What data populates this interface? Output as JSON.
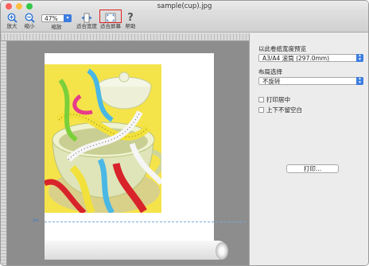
{
  "window": {
    "title": "sample(cup).jpg",
    "traffic_lights": [
      {
        "name": "close",
        "color": "#fc615d"
      },
      {
        "name": "minimize",
        "color": "#fdbc40"
      },
      {
        "name": "zoom",
        "color": "#34c84a"
      }
    ]
  },
  "toolbar": {
    "zoom_in_label": "放大",
    "zoom_out_label": "缩小",
    "zoom_value": "47%",
    "zoom_label": "缩放",
    "fit_width_label": "适合宽度",
    "fit_screen_label": "适合屏幕",
    "help_label": "帮助",
    "help_icon": "?",
    "highlight_color": "#e02020"
  },
  "sidebar": {
    "preview_heading": "以此卷纸宽度预览",
    "paper_select_value": "A3/A4 滚筒 (297.0mm)",
    "layout_heading": "布局选择",
    "layout_select_value": "不旋转",
    "center_print_label": "打印居中",
    "no_margin_label": "上下不留空白",
    "print_button_label": "打印..."
  },
  "icons": {
    "scissors": "✂",
    "dropdown": "▾"
  },
  "colors": {
    "accent": "#3d7de0",
    "photo_background": "#f5e34a"
  }
}
